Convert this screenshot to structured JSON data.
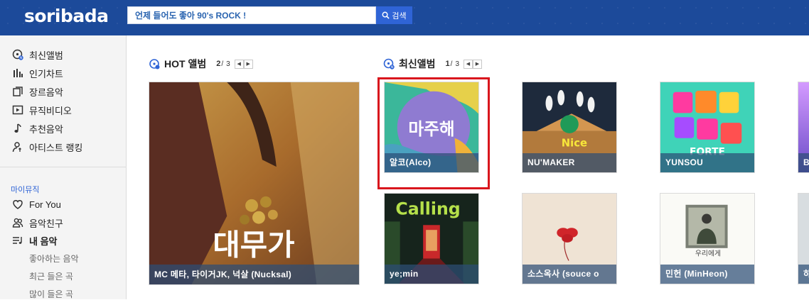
{
  "header": {
    "logo": "soribada",
    "search_value": "언제 들어도 좋아 90's ROCK !",
    "search_button": "검색"
  },
  "sidebar": {
    "nav": [
      {
        "label": "최신앨범",
        "icon": "new-album-icon"
      },
      {
        "label": "인기차트",
        "icon": "chart-bars-icon"
      },
      {
        "label": "장르음악",
        "icon": "genre-copy-icon"
      },
      {
        "label": "뮤직비디오",
        "icon": "play-video-icon"
      },
      {
        "label": "추천음악",
        "icon": "music-note-icon"
      },
      {
        "label": "아티스트 랭킹",
        "icon": "artist-ranking-icon"
      }
    ],
    "mymusic": {
      "title": "마이뮤직",
      "items": [
        {
          "label": "For You",
          "icon": "heart-icon"
        },
        {
          "label": "음악친구",
          "icon": "friends-icon"
        },
        {
          "label": "내 음악",
          "icon": "playlist-icon"
        }
      ],
      "subitems": [
        "좋아하는 음악",
        "최근 들은 곡",
        "많이 들은 곡"
      ]
    }
  },
  "hot_album": {
    "title": "HOT 앨범",
    "page_current": "2",
    "page_total": "3",
    "album": {
      "label": "MC 메타, 타이거JK, 넉살 (Nucksal)",
      "art_text": "대무가"
    }
  },
  "new_album": {
    "title": "최신앨범",
    "page_current": "1",
    "page_total": "3",
    "albums": [
      {
        "label": "알코(Alco)",
        "art_text": "마주해"
      },
      {
        "label": "NU'MAKER",
        "art_text": "Nice"
      },
      {
        "label": "YUNSOU",
        "art_text": "FORTE"
      },
      {
        "label": "B"
      },
      {
        "label": "ye;min",
        "art_text": "Calling"
      },
      {
        "label": "소스옥사 (souce o"
      },
      {
        "label": "민헌 (MinHeon)",
        "art_text": "우리에게"
      },
      {
        "label": "하"
      }
    ]
  },
  "colors": {
    "header_bg": "#1c4a9a",
    "accent_blue": "#2f64d6",
    "highlight_red": "#d9161d",
    "label_overlay": "rgba(44,78,118,0.72)"
  }
}
